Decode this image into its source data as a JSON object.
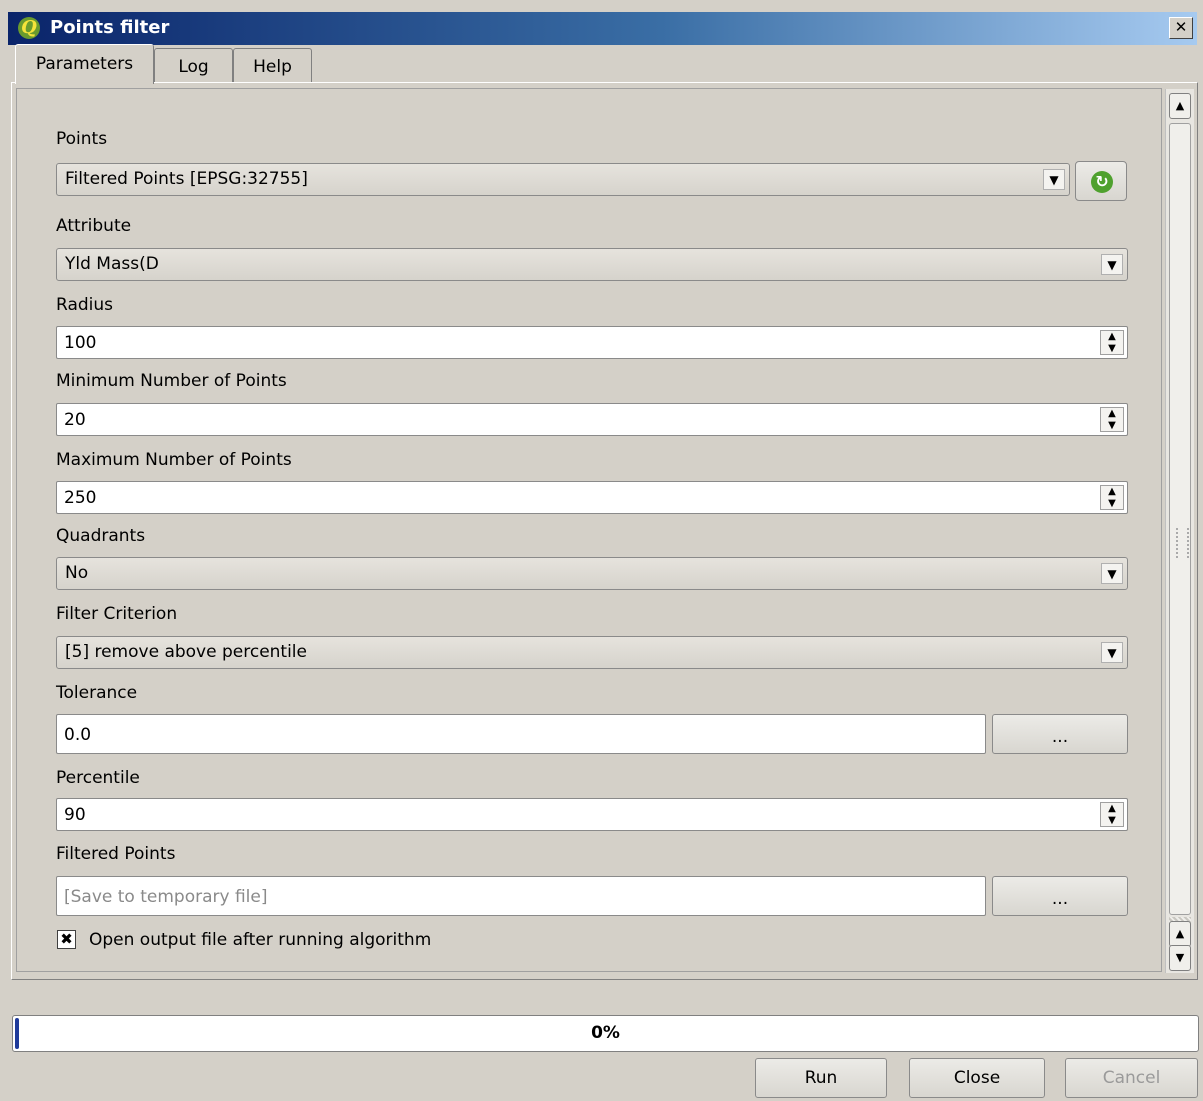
{
  "window": {
    "title": "Points filter",
    "close_glyph": "✕",
    "app_icon": "qgis-logo-icon",
    "app_icon_glyph": "Q"
  },
  "tabs": [
    {
      "label": "Parameters",
      "active": true
    },
    {
      "label": "Log",
      "active": false
    },
    {
      "label": "Help",
      "active": false
    }
  ],
  "params": {
    "points": {
      "label": "Points",
      "value": "Filtered Points [EPSG:32755]"
    },
    "attribute": {
      "label": "Attribute",
      "value": "Yld Mass(D"
    },
    "radius": {
      "label": "Radius",
      "value": "100"
    },
    "min_points": {
      "label": "Minimum Number of Points",
      "value": "20"
    },
    "max_points": {
      "label": "Maximum Number of Points",
      "value": "250"
    },
    "quadrants": {
      "label": "Quadrants",
      "value": "No"
    },
    "filter_criterion": {
      "label": "Filter Criterion",
      "value": "[5] remove above percentile"
    },
    "tolerance": {
      "label": "Tolerance",
      "value": "0.0",
      "button": "..."
    },
    "percentile": {
      "label": "Percentile",
      "value": "90"
    },
    "filtered_points": {
      "label": "Filtered Points",
      "placeholder": "[Save to temporary file]",
      "button": "..."
    },
    "open_output": {
      "label": "Open output file after running algorithm",
      "checked": true,
      "check_glyph": "✖"
    }
  },
  "icons": {
    "dropdown_arrow": "▼",
    "spin_up": "▲",
    "spin_down": "▼",
    "refresh": "↻"
  },
  "progress": {
    "value": 0,
    "text": "0%",
    "fill_color": "#1f3a9a"
  },
  "buttons": {
    "run": "Run",
    "close": "Close",
    "cancel": "Cancel"
  }
}
